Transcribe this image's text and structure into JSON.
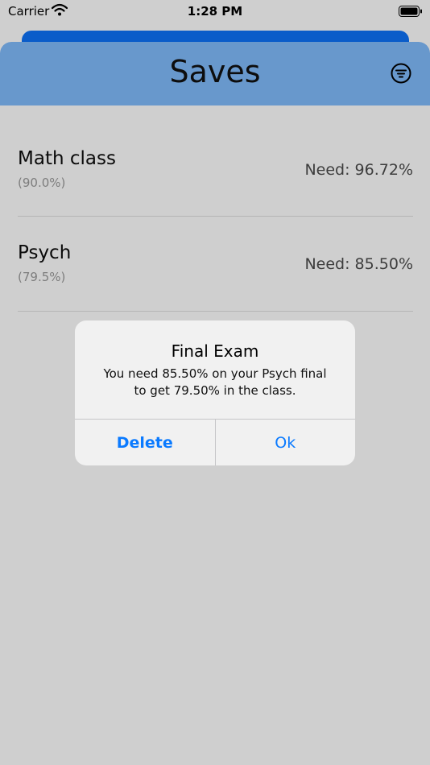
{
  "status_bar": {
    "carrier": "Carrier",
    "time": "1:28 PM"
  },
  "screen": {
    "title": "Saves",
    "filter_icon": "filter-icon"
  },
  "saves": [
    {
      "name": "Math class",
      "grade": "(90.0%)",
      "need": "Need: 96.72%"
    },
    {
      "name": "Psych",
      "grade": "(79.5%)",
      "need": "Need: 85.50%"
    }
  ],
  "alert": {
    "title": "Final Exam",
    "message_line1": "You need 85.50% on your Psych final",
    "message_line2": "to get 79.50% in the class.",
    "delete_label": "Delete",
    "ok_label": "Ok"
  },
  "colors": {
    "header": "#6898cc",
    "back_sheet": "#0a5cc9",
    "background": "#cfcfcf",
    "alert_button": "#0a7aff"
  }
}
